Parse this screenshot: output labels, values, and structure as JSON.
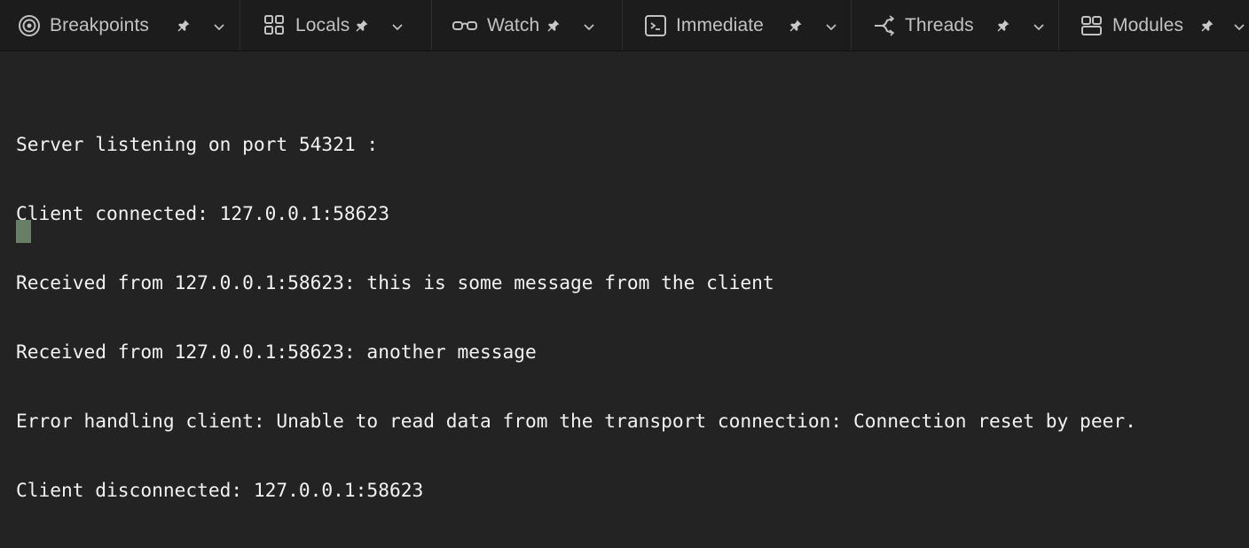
{
  "tabs": [
    {
      "label": "Breakpoints",
      "icon": "breakpoints-icon"
    },
    {
      "label": "Locals",
      "icon": "locals-grid-icon"
    },
    {
      "label": "Watch",
      "icon": "watch-glasses-icon"
    },
    {
      "label": "Immediate",
      "icon": "immediate-terminal-icon"
    },
    {
      "label": "Threads",
      "icon": "threads-icon"
    },
    {
      "label": "Modules",
      "icon": "modules-icon"
    }
  ],
  "console": {
    "lines": [
      "Server listening on port 54321 :",
      "Client connected: 127.0.0.1:58623",
      "Received from 127.0.0.1:58623: this is some message from the client",
      "Received from 127.0.0.1:58623: another message",
      "Error handling client: Unable to read data from the transport connection: Connection reset by peer.",
      "Client disconnected: 127.0.0.1:58623"
    ]
  },
  "colors": {
    "tabbar_bg": "#1c1c1c",
    "console_bg": "#232323",
    "text": "#f2f2f2",
    "cursor": "#6e8a6e"
  }
}
